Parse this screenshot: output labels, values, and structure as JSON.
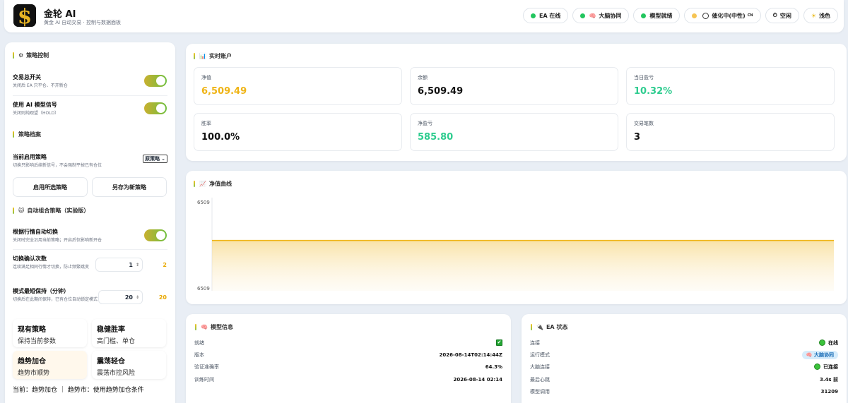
{
  "header": {
    "app_title": "金轮 AI",
    "app_subtitle": "黄金 AI 自动交易 · 控制与数据面板",
    "pills": {
      "ea_online": "EA 在线",
      "brain_sync": "大脑协同",
      "model_ready": "模型就绪",
      "sentiment": "催化中(中性)",
      "sentiment_suffix": "CN",
      "flat": "空闲",
      "theme": "浅色"
    }
  },
  "strategy": {
    "section_title": "策略控制",
    "master_switch": {
      "label": "交易总开关",
      "desc": "关闭后 EA 只平仓、不开新仓",
      "on": true
    },
    "ai_signal": {
      "label": "使用 AI 模型信号",
      "desc": "关闭则纯观望（HOLD）",
      "on": true
    },
    "profile_title": "策略档案",
    "current_profile": {
      "label": "当前启用策略",
      "desc": "切换只影响后续新信号，不会强制平掉已有仓位",
      "selected": "原策略"
    },
    "apply_button": "启用所选策略",
    "save_as_button": "另存为新策略",
    "auto_title": "自动组合策略（实验版）",
    "auto_switch": {
      "label": "根据行情自动切换",
      "desc": "关闭时完全沿用当前策略；开启后仅影响新开仓",
      "on": true
    },
    "confirm_count": {
      "label": "切换确认次数",
      "desc": "连续满足相同行情才切换，防止频繁跳变",
      "input": "1",
      "value": "2"
    },
    "min_hold": {
      "label": "模式最短保持（分钟）",
      "desc": "切换后在此期间保持，已有仓位自动锁定模式",
      "input": "20",
      "value": "20"
    },
    "modes": [
      {
        "name": "现有策略",
        "desc": "保持当前参数"
      },
      {
        "name": "稳健胜率",
        "desc": "高门槛、单仓"
      },
      {
        "name": "趋势加仓",
        "desc": "趋势市顺势"
      },
      {
        "name": "震荡轻仓",
        "desc": "震荡市控风险"
      }
    ],
    "current_line": "当前：趋势加仓 ｜ 趋势市：使用趋势加仓条件"
  },
  "account": {
    "section_title": "实时账户",
    "stats": [
      {
        "label": "净值",
        "value": "6,509.49",
        "tone": "gold"
      },
      {
        "label": "余额",
        "value": "6,509.49",
        "tone": "dark"
      },
      {
        "label": "当日盈亏",
        "value": "10.32%",
        "tone": "green"
      },
      {
        "label": "胜率",
        "value": "100.0%",
        "tone": "dark"
      },
      {
        "label": "净盈亏",
        "value": "585.80",
        "tone": "green"
      },
      {
        "label": "交易笔数",
        "value": "3",
        "tone": "dark"
      }
    ]
  },
  "equity": {
    "section_title": "净值曲线",
    "y_top_label": "6509",
    "y_bottom_label": "6509"
  },
  "chart_data": {
    "type": "area",
    "title": "",
    "xlabel": "",
    "ylabel": "",
    "y_tick_labels": [
      "6509",
      "6509"
    ],
    "series": [
      {
        "values": [
          6509.49,
          6509.49
        ]
      }
    ],
    "color": "#efb416",
    "grid": false
  },
  "model_info": {
    "section_title": "模型信息",
    "rows": [
      {
        "k": "就绪",
        "v": "✔"
      },
      {
        "k": "版本",
        "v": "2026-08-14T02:14:44Z"
      },
      {
        "k": "验证准确率",
        "v": "64.3%"
      },
      {
        "k": "训练时间",
        "v": "2026-08-14 02:14"
      }
    ]
  },
  "ea_status": {
    "section_title": "EA 状态",
    "rows": [
      {
        "k": "连接",
        "v": "在线"
      },
      {
        "k": "运行模式",
        "v": "大脑协同"
      },
      {
        "k": "大脑连接",
        "v": "已连接"
      },
      {
        "k": "最后心跳",
        "v": "3.4s 前"
      },
      {
        "k": "模型调用",
        "v": "31209"
      }
    ]
  },
  "colors": {
    "accent": "#efb416",
    "positive": "#2ecc8f",
    "online": "#22c55e",
    "toggle": "#6fbf3f"
  }
}
